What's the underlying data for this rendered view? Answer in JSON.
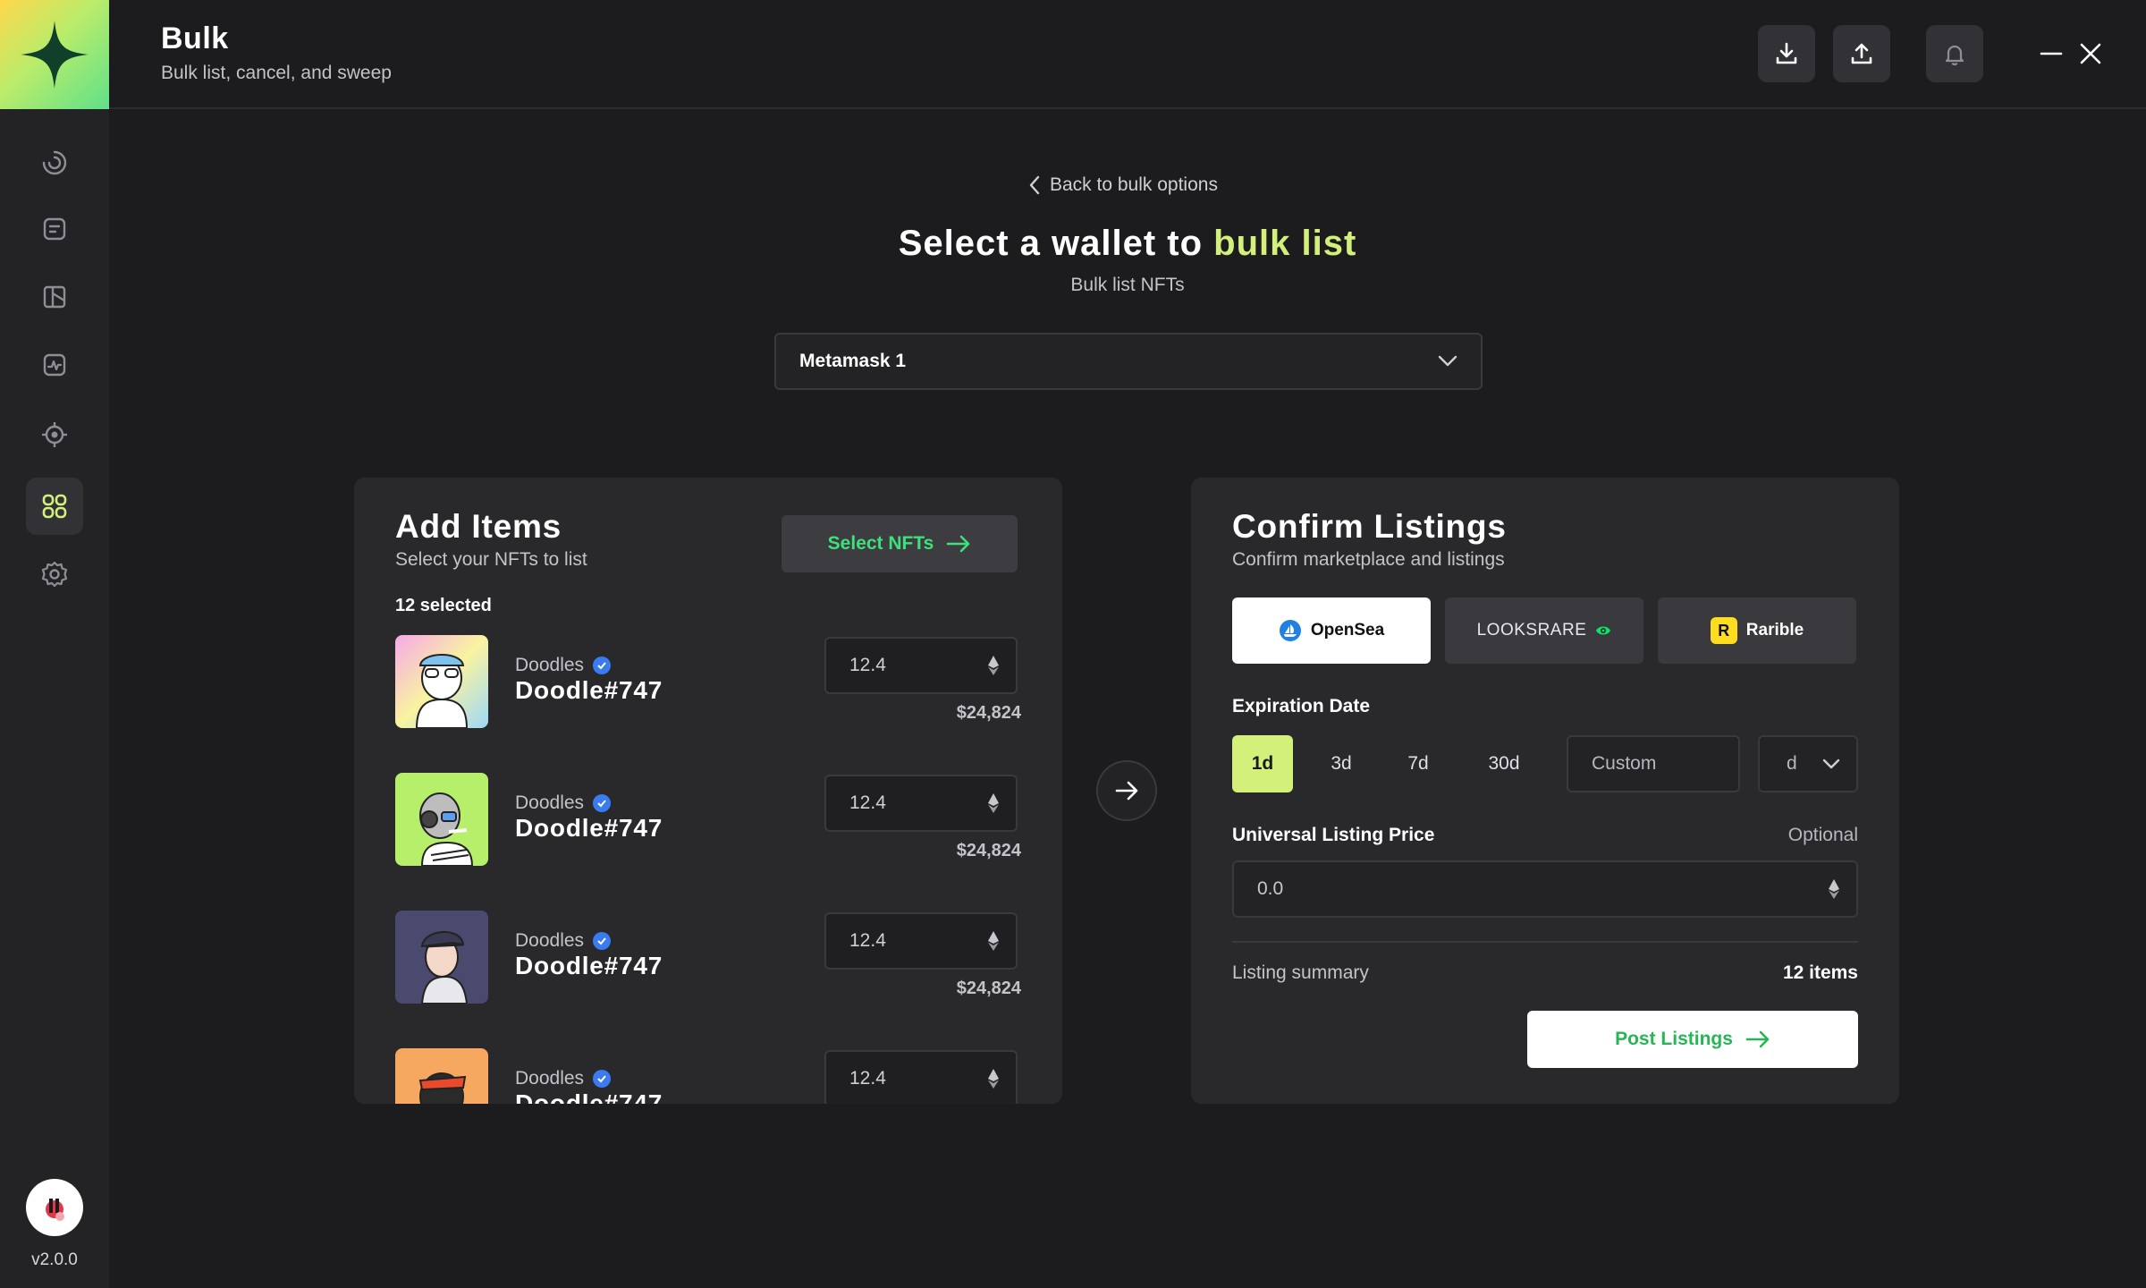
{
  "app": {
    "version": "v2.0.0",
    "header": {
      "title": "Bulk",
      "subtitle": "Bulk list, cancel, and sweep"
    },
    "header_icons": [
      "download-icon",
      "upload-icon",
      "bell-icon",
      "minimize-icon",
      "close-icon"
    ],
    "sidebar": {
      "items": [
        {
          "icon": "activity-spinner-icon",
          "active": false
        },
        {
          "icon": "notes-icon",
          "active": false
        },
        {
          "icon": "portfolio-icon",
          "active": false
        },
        {
          "icon": "analytics-icon",
          "active": false
        },
        {
          "icon": "target-icon",
          "active": false
        },
        {
          "icon": "grid-icon",
          "active": true
        },
        {
          "icon": "settings-icon",
          "active": false
        }
      ]
    },
    "accent_color": "#d2f07a"
  },
  "hero": {
    "back_label": "Back to bulk options",
    "title_prefix": "Select a wallet to",
    "title_accent": "bulk list",
    "subtitle": "Bulk list NFTs",
    "wallet": "Metamask 1"
  },
  "add_items": {
    "title": "Add Items",
    "subtitle": "Select your NFTs to list",
    "select_button": "Select NFTs",
    "selected_count": "12 selected",
    "items": [
      {
        "collection": "Doodles",
        "name": "Doodle#747",
        "price": "12.4",
        "usd": "$24,824"
      },
      {
        "collection": "Doodles",
        "name": "Doodle#747",
        "price": "12.4",
        "usd": "$24,824"
      },
      {
        "collection": "Doodles",
        "name": "Doodle#747",
        "price": "12.4",
        "usd": "$24,824"
      },
      {
        "collection": "Doodles",
        "name": "Doodle#747",
        "price": "12.4",
        "usd": ""
      }
    ]
  },
  "confirm": {
    "title": "Confirm Listings",
    "subtitle": "Confirm marketplace and listings",
    "marketplaces": [
      {
        "label": "OpenSea",
        "active": true
      },
      {
        "label": "LOOKSRARE",
        "active": false
      },
      {
        "label": "Rarible",
        "active": false
      }
    ],
    "expiration_label": "Expiration Date",
    "expiration_options": [
      "1d",
      "3d",
      "7d",
      "30d"
    ],
    "expiration_selected": "1d",
    "custom_placeholder": "Custom",
    "unit": "d",
    "price_label": "Universal Listing Price",
    "price_optional": "Optional",
    "price_value": "0.0",
    "summary_label": "Listing summary",
    "summary_value": "12 items",
    "post_button": "Post Listings"
  }
}
